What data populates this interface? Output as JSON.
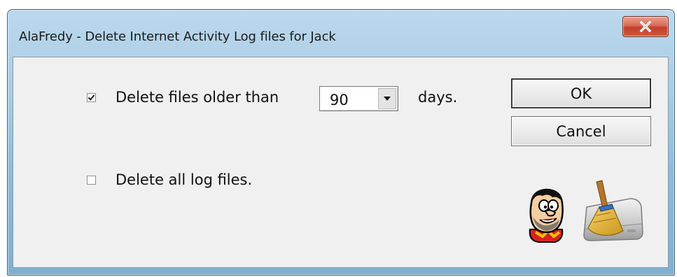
{
  "window": {
    "title": "AlaFredy - Delete Internet Activity Log files for Jack",
    "close_icon": "close-icon"
  },
  "options": {
    "older_than": {
      "checked": true,
      "label_before": "Delete files older than",
      "days_value": "90",
      "label_after": "days."
    },
    "delete_all": {
      "checked": false,
      "label": "Delete all log files."
    }
  },
  "buttons": {
    "ok": "OK",
    "cancel": "Cancel"
  },
  "icons": {
    "mascot": "fred-mascot-icon",
    "cleaner": "broom-drive-icon",
    "dropdown": "chevron-down-icon",
    "check": "checkmark-icon"
  },
  "colors": {
    "titlebar": "#a9cde6",
    "client_bg": "#f0f0f0",
    "close_button": "#c3402b"
  }
}
